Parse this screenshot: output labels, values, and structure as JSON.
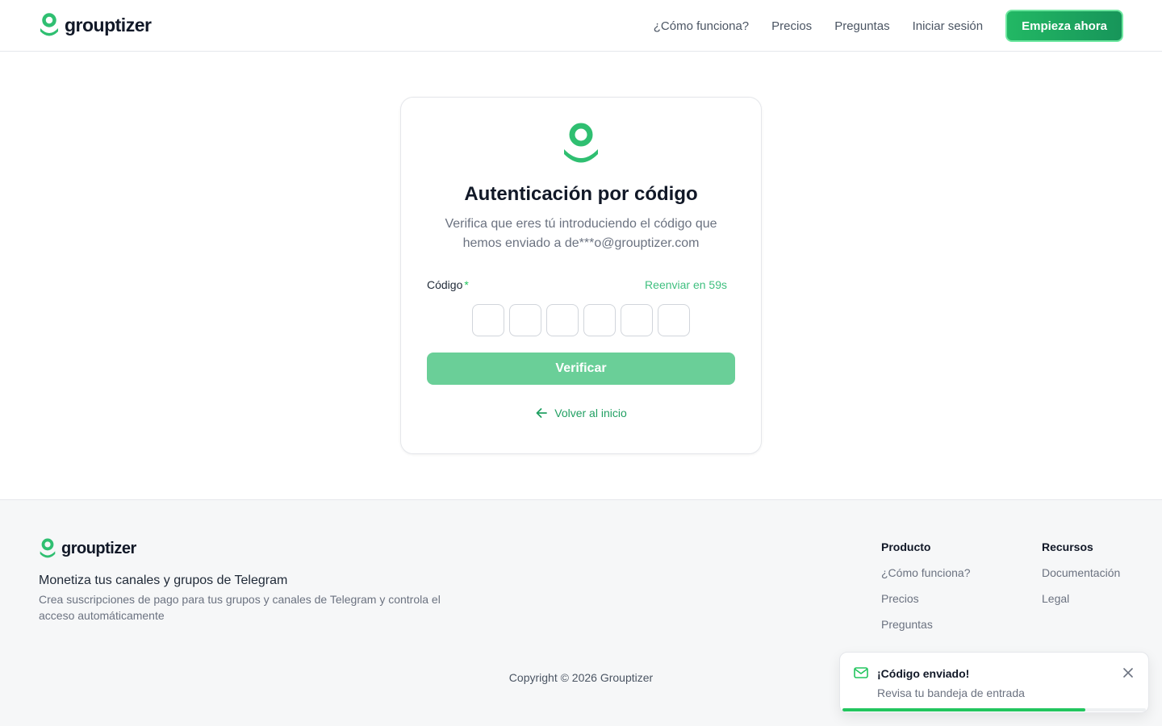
{
  "brand": {
    "name": "grouptizer",
    "accent": "#22c55e"
  },
  "header": {
    "nav": [
      {
        "label": "¿Cómo funciona?"
      },
      {
        "label": "Precios"
      },
      {
        "label": "Preguntas"
      },
      {
        "label": "Iniciar sesión"
      }
    ],
    "cta": "Empieza ahora"
  },
  "auth": {
    "icon": "user-pin-icon",
    "title": "Autenticación por código",
    "subtitle": "Verifica que eres tú introduciendo el código que hemos enviado a de***o@grouptizer.com",
    "code_label": "Código",
    "required_mark": "*",
    "resend": "Reenviar en 59s",
    "digits": [
      "",
      "",
      "",
      "",
      "",
      ""
    ],
    "verify": "Verificar",
    "back": "Volver al inicio"
  },
  "footer": {
    "tagline": "Monetiza tus canales y grupos de Telegram",
    "description": "Crea suscripciones de pago para tus grupos y canales de Telegram y controla el acceso automáticamente",
    "product": {
      "title": "Producto",
      "links": [
        "¿Cómo funciona?",
        "Precios",
        "Preguntas"
      ]
    },
    "resources": {
      "title": "Recursos",
      "links": [
        "Documentación",
        "Legal"
      ]
    },
    "copyright": "Copyright © 2026 Grouptizer"
  },
  "toast": {
    "icon": "mail-check-icon",
    "title": "¡Código enviado!",
    "message": "Revisa tu bandeja de entrada",
    "progress": 0.8
  }
}
